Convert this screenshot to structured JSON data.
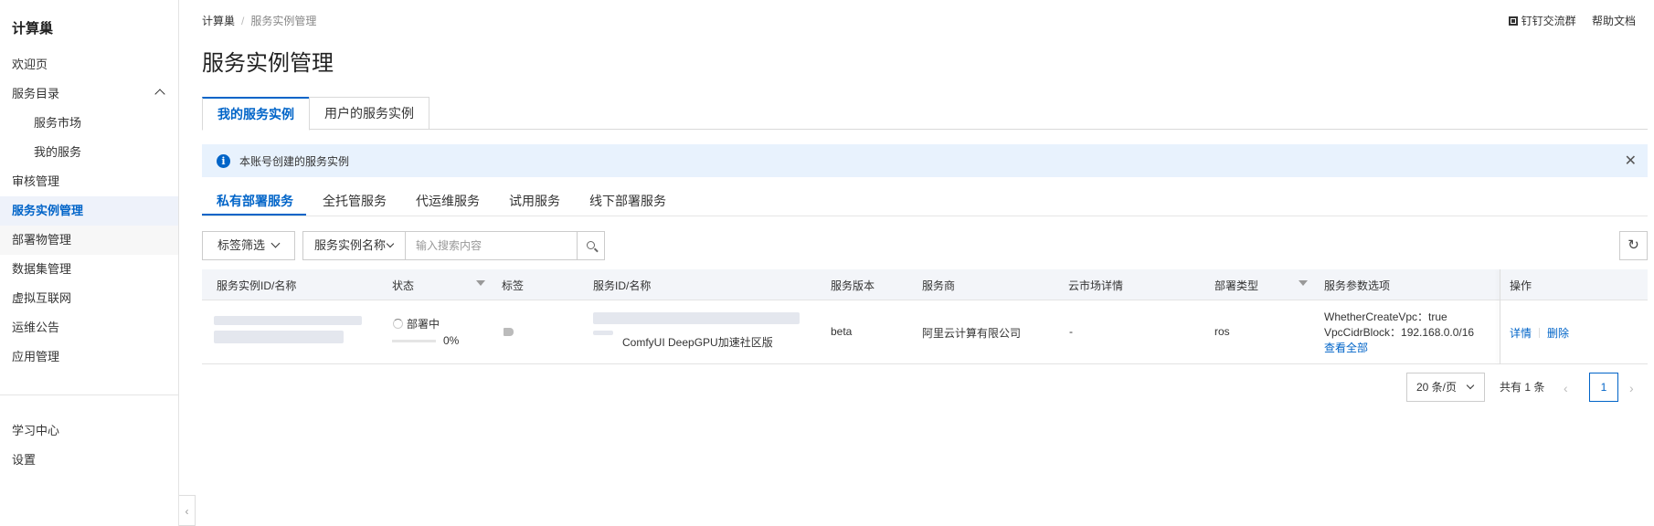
{
  "sidebar": {
    "brand": "计算巢",
    "items": [
      {
        "label": "欢迎页"
      },
      {
        "label": "服务目录"
      },
      {
        "label": "服务市场"
      },
      {
        "label": "我的服务"
      },
      {
        "label": "审核管理"
      },
      {
        "label": "服务实例管理"
      },
      {
        "label": "部署物管理"
      },
      {
        "label": "数据集管理"
      },
      {
        "label": "虚拟互联网"
      },
      {
        "label": "运维公告"
      },
      {
        "label": "应用管理"
      }
    ],
    "bottom": [
      {
        "label": "学习中心"
      },
      {
        "label": "设置"
      }
    ]
  },
  "header": {
    "breadcrumb": [
      "计算巢",
      "服务实例管理"
    ],
    "dingtalk_label": "钉钉交流群",
    "help_label": "帮助文档",
    "title": "服务实例管理"
  },
  "main_tabs": [
    {
      "label": "我的服务实例"
    },
    {
      "label": "用户的服务实例"
    }
  ],
  "alert": {
    "text": "本账号创建的服务实例"
  },
  "sub_tabs": [
    {
      "label": "私有部署服务"
    },
    {
      "label": "全托管服务"
    },
    {
      "label": "代运维服务"
    },
    {
      "label": "试用服务"
    },
    {
      "label": "线下部署服务"
    }
  ],
  "toolbar": {
    "tag_filter_label": "标签筛选",
    "search_field_label": "服务实例名称",
    "search_placeholder": "输入搜索内容"
  },
  "table": {
    "columns": [
      "服务实例ID/名称",
      "状态",
      "标签",
      "服务ID/名称",
      "服务版本",
      "服务商",
      "云市场详情",
      "部署类型",
      "服务参数选项",
      "操作"
    ],
    "rows": [
      {
        "status": "部署中",
        "progress_label": "0%",
        "progress": 0,
        "service_name": "ComfyUI DeepGPU加速社区版",
        "version": "beta",
        "provider": "阿里云计算有限公司",
        "market": "-",
        "deploy_type": "ros",
        "param1": "WhetherCreateVpc：true",
        "param2": "VpcCidrBlock：192.168.0.0/16",
        "view_all": "查看全部",
        "detail": "详情",
        "delete": "删除"
      }
    ]
  },
  "pagination": {
    "page_size": "20 条/页",
    "total": "共有 1 条",
    "current": "1"
  },
  "colors": {
    "accent": "#0064c8",
    "alert_bg": "#e8f2fd",
    "header_bg": "#f3f5f9"
  }
}
